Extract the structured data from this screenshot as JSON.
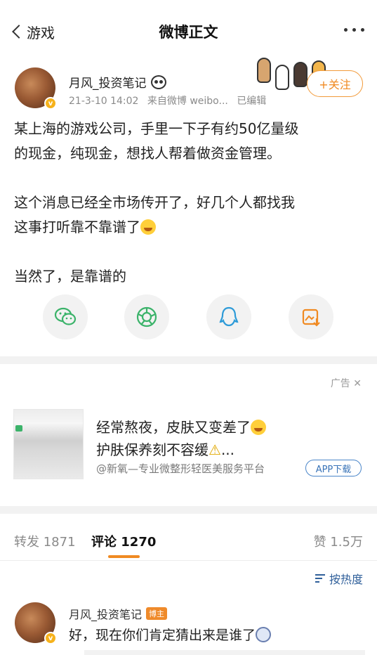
{
  "nav": {
    "back_label": "游戏",
    "title": "微博正文"
  },
  "post": {
    "author": "月风_投资笔记",
    "time": "21-3-10 14:02",
    "source": "来自微博 weibo...",
    "edited": "已编辑",
    "follow_label": "+关注",
    "paragraph1_line1": "某上海的游戏公司，手里一下子有约50亿量级",
    "paragraph1_line2": "的现金，纯现金，想找人帮着做资金管理。",
    "paragraph2_line1": "这个消息已经全市场传开了，好几个人都找我",
    "paragraph2_line2": "这事打听靠不靠谱了",
    "paragraph3": "当然了，是靠谱的"
  },
  "share": {
    "icons": [
      "wechat-icon",
      "moments-icon",
      "qq-icon",
      "save-image-icon"
    ]
  },
  "ad": {
    "tag": "广告",
    "line1": "经常熬夜，皮肤又变差了",
    "line2": "护肤保养刻不容缓",
    "line2_suffix": "...",
    "source": "@新氧—专业微整形轻医美服务平台",
    "button": "APP下载"
  },
  "tabs": {
    "repost_label": "转发",
    "repost_count": "1871",
    "comment_label": "评论",
    "comment_count": "1270",
    "like_label": "赞",
    "like_count": "1.5万"
  },
  "sort": {
    "label": "按热度"
  },
  "comment": {
    "author": "月风_投资笔记",
    "badge": "博主",
    "text": "好，现在你们肯定猜出来是谁了"
  },
  "colors": {
    "accent": "#f08a22",
    "link": "#2f5f9a"
  }
}
